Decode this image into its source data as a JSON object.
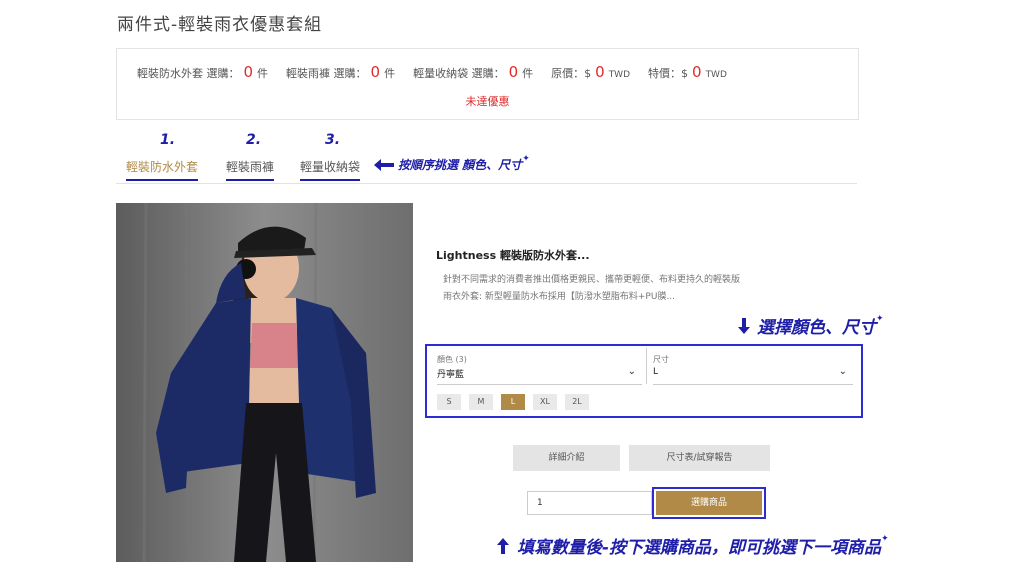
{
  "page": {
    "title": "兩件式-輕裝雨衣優惠套組"
  },
  "summary": {
    "items": [
      {
        "label": "輕裝防水外套 選購：",
        "count": "0",
        "unit": "件"
      },
      {
        "label": "輕裝雨褲 選購：",
        "count": "0",
        "unit": "件"
      },
      {
        "label": "輕量收納袋 選購：",
        "count": "0",
        "unit": "件"
      }
    ],
    "original_label": "原價：$",
    "original_value": "0",
    "special_label": "特價：$",
    "special_value": "0",
    "currency": "TWD",
    "status": "未達優惠"
  },
  "steps": [
    "1.",
    "2.",
    "3."
  ],
  "tabs": [
    {
      "label": "輕裝防水外套",
      "active": true
    },
    {
      "label": "輕裝雨褲",
      "active": false
    },
    {
      "label": "輕量收納袋",
      "active": false
    }
  ],
  "hints": {
    "tabs": "按順序挑選 顏色、尺寸",
    "select": "選擇顏色、尺寸",
    "buy": "填寫數量後-按下選購商品，即可挑選下一項商品"
  },
  "product": {
    "title": "Lightness 輕裝版防水外套...",
    "description": "針對不同需求的消費者推出價格更親民、攜帶更輕便、布料更持久的輕裝版雨衣外套: 新型輕量防水布採用【防潑水塑脂布料+PU膜..."
  },
  "selector": {
    "color_label": "顏色 (3)",
    "color_value": "丹寧藍",
    "size_label": "尺寸",
    "size_value": "L",
    "sizes": [
      "S",
      "M",
      "L",
      "XL",
      "2L"
    ],
    "selected_size": "L"
  },
  "buttons": {
    "details": "詳細介紹",
    "size_chart": "尺寸表/試穿報告",
    "buy": "選購商品"
  },
  "quantity": {
    "value": "1"
  },
  "colors": {
    "accent_gold": "#b08a46",
    "annotation_blue": "#1e1ea8",
    "alert_red": "#e02a2a"
  }
}
